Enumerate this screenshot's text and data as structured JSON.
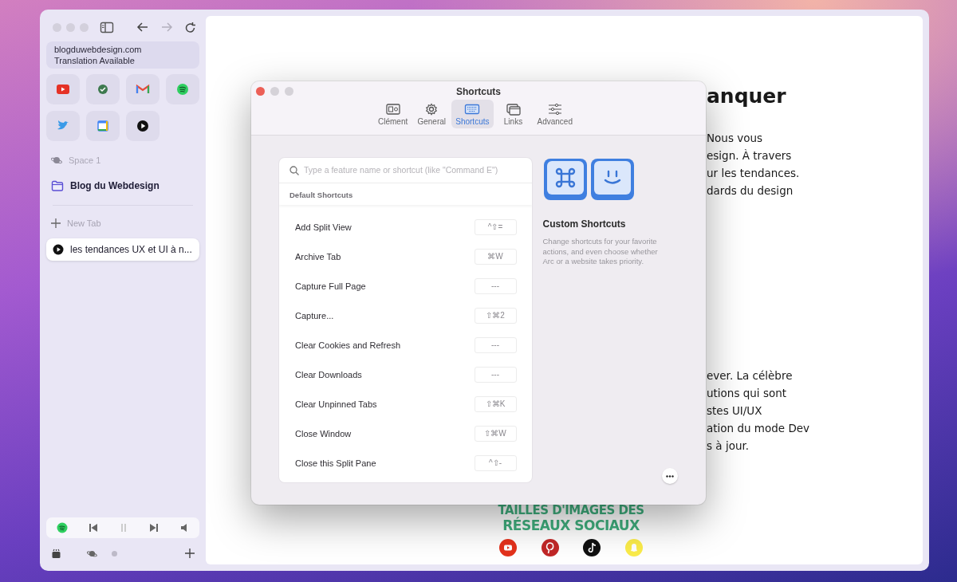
{
  "browser": {
    "url": "blogduwebdesign.com",
    "url_note": "Translation Available",
    "space": "Space 1",
    "folder": "Blog du Webdesign",
    "new_tab": "New Tab",
    "tabs": [
      {
        "title": "les tendances UX et UI à n...",
        "selected": true
      }
    ]
  },
  "page": {
    "heading": "anquer",
    "paragraph_1": [
      "Nous vous",
      "esign. À travers",
      "ur les tendances.",
      "dards du design"
    ],
    "paragraph_2": [
      "ever. La célèbre",
      "utions qui sont",
      "stes UI/UX",
      "ation du mode Dev",
      "s à jour."
    ],
    "banner": {
      "line_1": "TAILLES D'IMAGES DES",
      "line_2": "RÉSEAUX SOCIAUX"
    }
  },
  "dialog": {
    "title": "Shortcuts",
    "tabs": [
      {
        "label": "Clément",
        "selected": false
      },
      {
        "label": "General",
        "selected": false
      },
      {
        "label": "Shortcuts",
        "selected": true
      },
      {
        "label": "Links",
        "selected": false
      },
      {
        "label": "Advanced",
        "selected": false
      }
    ],
    "search": {
      "placeholder": "Type a feature name or shortcut (like \"Command E\")"
    },
    "section": "Default Shortcuts",
    "shortcuts": [
      {
        "name": "Add Split View",
        "keys": "^⇧="
      },
      {
        "name": "Archive Tab",
        "keys": "⌘W"
      },
      {
        "name": "Capture Full Page",
        "keys": "---"
      },
      {
        "name": "Capture...",
        "keys": "⇧⌘2"
      },
      {
        "name": "Clear Cookies and Refresh",
        "keys": "---"
      },
      {
        "name": "Clear Downloads",
        "keys": "---"
      },
      {
        "name": "Clear Unpinned Tabs",
        "keys": "⇧⌘K"
      },
      {
        "name": "Close Window",
        "keys": "⇧⌘W"
      },
      {
        "name": "Close this Split Pane",
        "keys": "^⇧-"
      }
    ],
    "info": {
      "title": "Custom Shortcuts",
      "text": "Change shortcuts for your favorite actions, and even choose whether Arc or a website takes priority."
    }
  }
}
